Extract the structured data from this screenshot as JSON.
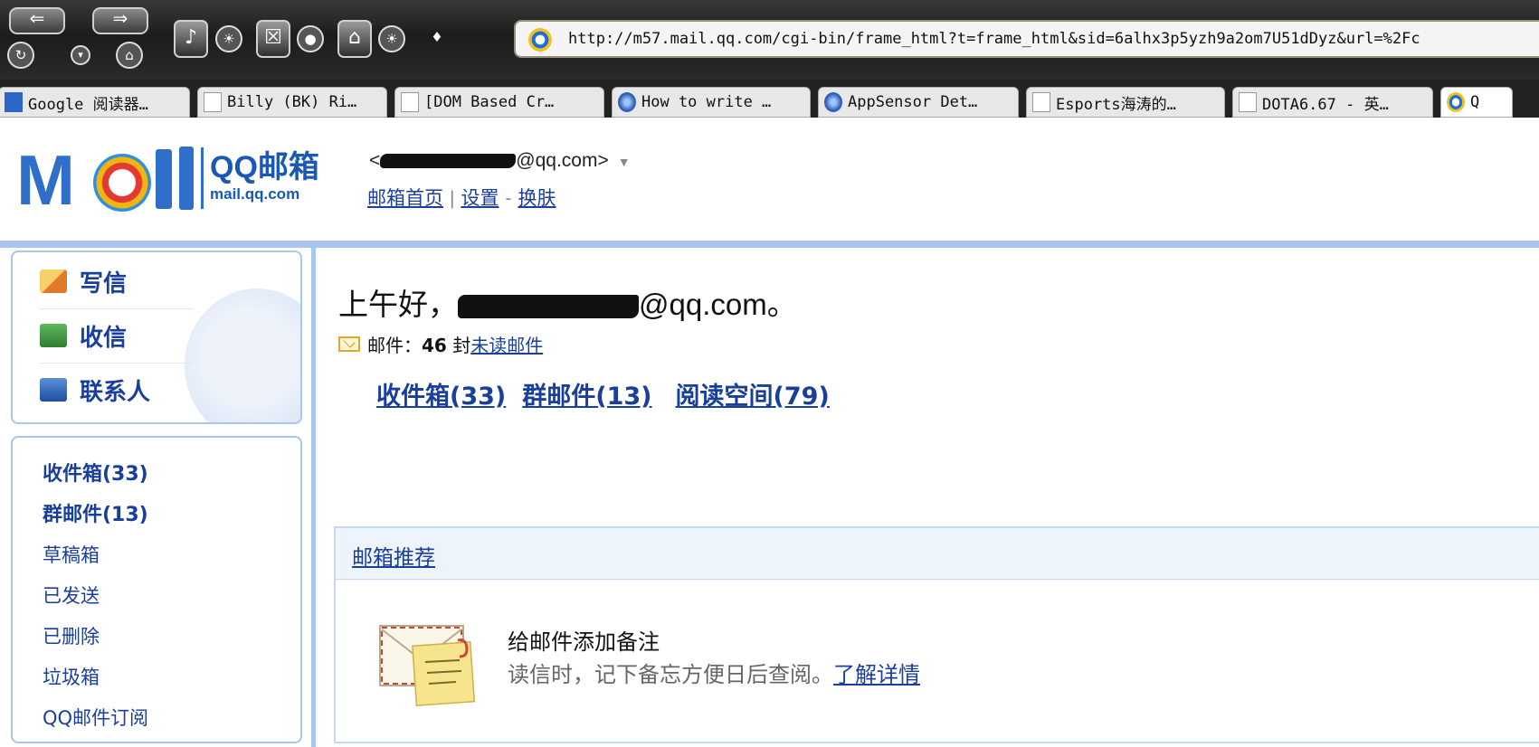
{
  "browser": {
    "url": "http://m57.mail.qq.com/cgi-bin/frame_html?t=frame_html&sid=6alhx3p5yzh9a2om7U51dDyz&url=%2Fc",
    "tabs": [
      {
        "label": "Google 阅读器…",
        "icon": "feed-icon"
      },
      {
        "label": "Billy (BK) Ri…",
        "icon": "page-icon"
      },
      {
        "label": "[DOM Based Cr…",
        "icon": "page-icon"
      },
      {
        "label": "How to write …",
        "icon": "globe-icon"
      },
      {
        "label": "AppSensor Det…",
        "icon": "globe-icon"
      },
      {
        "label": "Esports海涛的…",
        "icon": "page-icon"
      },
      {
        "label": "DOTA6.67 - 英…",
        "icon": "page-icon"
      },
      {
        "label": "Q",
        "icon": "qq-icon"
      }
    ]
  },
  "header": {
    "brand_name": "QQ邮箱",
    "brand_domain": "mail.qq.com",
    "account_prefix": "<",
    "account_suffix": "@qq.com>",
    "links": {
      "home": "邮箱首页",
      "settings": "设置",
      "skin": "换肤"
    },
    "separator_bar": "|",
    "separator_dash": "-"
  },
  "sidebar": {
    "actions": {
      "write": "写信",
      "receive": "收信",
      "contacts": "联系人"
    },
    "folders": [
      "收件箱(33)",
      "群邮件(13)",
      "草稿箱",
      "已发送",
      "已删除",
      "垃圾箱",
      "QQ邮件订阅"
    ]
  },
  "main": {
    "greeting_prefix": "上午好，",
    "greeting_suffix": "@qq.com。",
    "mail_label": "邮件：",
    "mail_count": "46",
    "mail_unit": "封",
    "unread_link": "未读邮件",
    "folder_links": [
      "收件箱(33)",
      "群邮件(13)",
      "阅读空间(79)"
    ],
    "recommend": {
      "heading": "邮箱推荐",
      "title": "给邮件添加备注",
      "desc": "读信时，记下备忘方便日后查阅。",
      "more_link": "了解详情"
    }
  }
}
